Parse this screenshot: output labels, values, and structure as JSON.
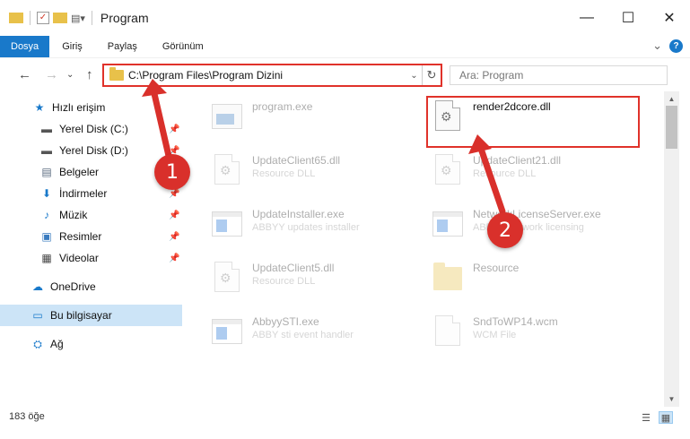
{
  "window": {
    "title": "Program",
    "controls": {
      "minimize": "—",
      "maximize": "☐",
      "close": "✕"
    }
  },
  "ribbon": {
    "tabs": [
      {
        "label": "Dosya",
        "active": true
      },
      {
        "label": "Giriş"
      },
      {
        "label": "Paylaş"
      },
      {
        "label": "Görünüm"
      }
    ],
    "expand_glyph": "⌄",
    "help_glyph": "?"
  },
  "navigation": {
    "back": "←",
    "forward": "→",
    "dropdown": "⌄",
    "up": "↑",
    "address_path": "C:\\Program Files\\Program Dizini",
    "address_dropdown": "⌄",
    "refresh": "↻",
    "search_placeholder": "Ara: Program"
  },
  "sidebar": {
    "items": [
      {
        "label": "Hızlı erişim",
        "icon": "star-icon",
        "glyph": "★",
        "color": "#1979ca"
      },
      {
        "label": "Yerel Disk (C:)",
        "icon": "drive-icon",
        "glyph": "▬",
        "color": "#555555",
        "pinned": true
      },
      {
        "label": "Yerel Disk (D:)",
        "icon": "drive-icon",
        "glyph": "▬",
        "color": "#555555",
        "pinned": true
      },
      {
        "label": "Belgeler",
        "icon": "documents-icon",
        "glyph": "▤",
        "color": "#5a6b80",
        "pinned": true
      },
      {
        "label": "İndirmeler",
        "icon": "download-icon",
        "glyph": "⬇",
        "color": "#1979ca",
        "pinned": true
      },
      {
        "label": "Müzik",
        "icon": "music-icon",
        "glyph": "♪",
        "color": "#1979ca",
        "pinned": true
      },
      {
        "label": "Resimler",
        "icon": "pictures-icon",
        "glyph": "▣",
        "color": "#3a7bbf",
        "pinned": true
      },
      {
        "label": "Videolar",
        "icon": "videos-icon",
        "glyph": "▦",
        "color": "#444444",
        "pinned": true
      },
      {
        "label": "OneDrive",
        "icon": "cloud-icon",
        "glyph": "☁",
        "color": "#1979ca"
      },
      {
        "label": "Bu bilgisayar",
        "icon": "computer-icon",
        "glyph": "▭",
        "color": "#1979ca",
        "selected": true
      },
      {
        "label": "Ağ",
        "icon": "network-icon",
        "glyph": "⛭",
        "color": "#1979ca"
      }
    ],
    "pin_glyph": "📌"
  },
  "files": [
    {
      "name": "program.exe",
      "desc": "",
      "icon": "installer-icon",
      "faded": true
    },
    {
      "name": "render2dcore.dll",
      "desc": "",
      "icon": "dll-icon",
      "faded": false,
      "highlighted": true
    },
    {
      "name": "UpdateClient65.dll",
      "desc": "Resource DLL",
      "icon": "dll-icon",
      "faded": true
    },
    {
      "name": "UpdateClient21.dll",
      "desc": "Resource DLL",
      "icon": "dll-icon",
      "faded": true
    },
    {
      "name": "UpdateInstaller.exe",
      "desc": "ABBYY updates installer",
      "icon": "exe-icon",
      "faded": true
    },
    {
      "name": "NetworkLicenseServer.exe",
      "desc": "ABBYY network licensing",
      "icon": "exe-icon",
      "faded": true
    },
    {
      "name": "UpdateClient5.dll",
      "desc": "Resource DLL",
      "icon": "dll-icon",
      "faded": true
    },
    {
      "name": "Resource",
      "desc": "",
      "icon": "folder-icon",
      "faded": true
    },
    {
      "name": "AbbyySTI.exe",
      "desc": "ABBY sti event handler",
      "icon": "exe-icon",
      "faded": true
    },
    {
      "name": "SndToWP14.wcm",
      "desc": "WCM File",
      "icon": "file-icon",
      "faded": true
    }
  ],
  "status": {
    "count": "183 öğe"
  },
  "annotations": [
    {
      "label": "1"
    },
    {
      "label": "2"
    }
  ],
  "colors": {
    "accent": "#1979ca",
    "highlight": "#e0322a",
    "annotation": "#d9302b",
    "selected": "#cce4f7"
  }
}
